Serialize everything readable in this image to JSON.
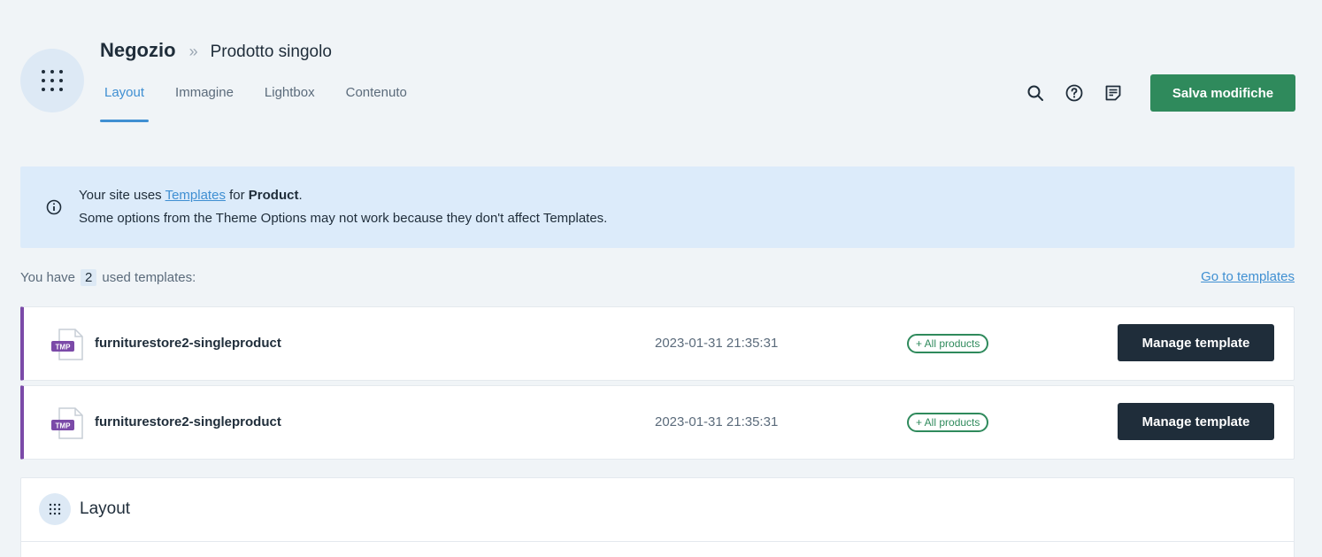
{
  "header": {
    "breadcrumb_root": "Negozio",
    "breadcrumb_separator": "»",
    "breadcrumb_page": "Prodotto singolo",
    "app_icon": "grid-dots-icon",
    "tabs": [
      {
        "label": "Layout",
        "active": true
      },
      {
        "label": "Immagine",
        "active": false
      },
      {
        "label": "Lightbox",
        "active": false
      },
      {
        "label": "Contenuto",
        "active": false
      }
    ],
    "actions": {
      "search_icon": "search-icon",
      "help_icon": "help-circle-icon",
      "notes_icon": "notes-icon",
      "save_label": "Salva modifiche"
    }
  },
  "notice": {
    "icon": "info-icon",
    "line1_prefix": "Your site uses ",
    "line1_link": "Templates",
    "line1_mid": " for ",
    "line1_bold": "Product",
    "line1_suffix": ".",
    "line2": "Some options from the Theme Options may not work because they don't affect Templates."
  },
  "templates_summary": {
    "prefix": "You have",
    "count": "2",
    "suffix": "used templates:",
    "go_link": "Go to templates"
  },
  "templates": [
    {
      "file_badge": "TMP",
      "name": "furniturestore2-singleproduct",
      "date": "2023-01-31 21:35:31",
      "scope": "+ All products",
      "action": "Manage template"
    },
    {
      "file_badge": "TMP",
      "name": "furniturestore2-singleproduct",
      "date": "2023-01-31 21:35:31",
      "scope": "+ All products",
      "action": "Manage template"
    }
  ],
  "section": {
    "icon": "grid-dots-icon",
    "title": "Layout"
  },
  "colors": {
    "accent": "#3f8fd2",
    "save": "#2f8a5c",
    "dark_button": "#1f2d3a",
    "template_accent": "#7b4aa8"
  }
}
